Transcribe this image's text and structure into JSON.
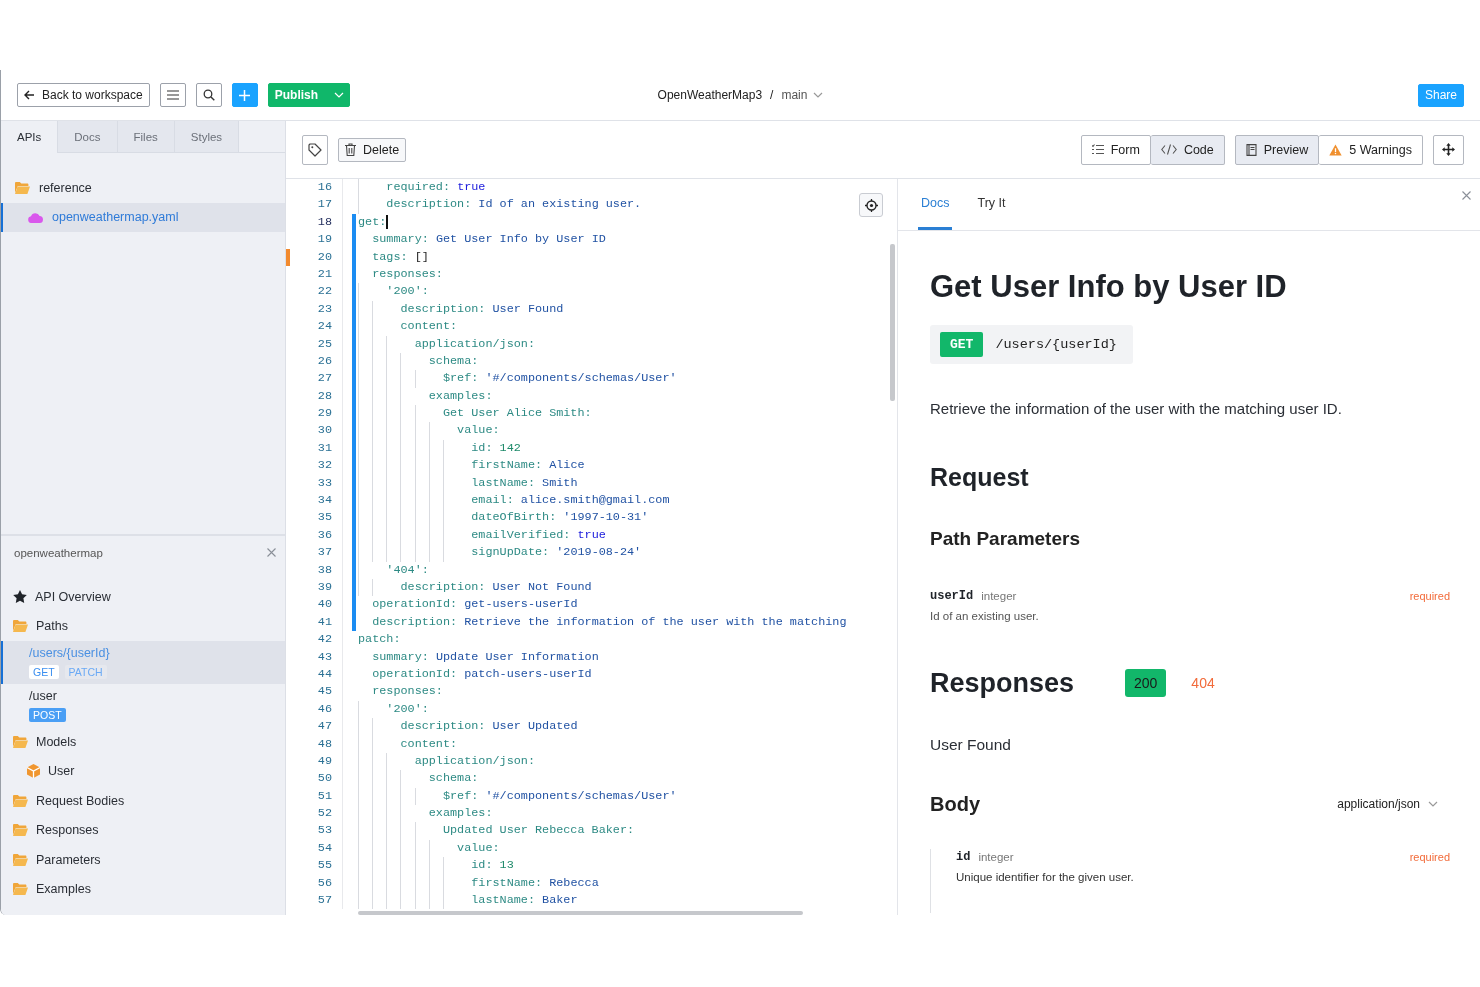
{
  "header": {
    "back_button": "Back to workspace",
    "publish_button": "Publish",
    "project": "OpenWeatherMap3",
    "separator": "/",
    "branch": "main",
    "share_button": "Share"
  },
  "sidebar": {
    "tabs": [
      {
        "label": "APIs",
        "selected": true
      },
      {
        "label": "Docs",
        "selected": false
      },
      {
        "label": "Files",
        "selected": false
      },
      {
        "label": "Styles",
        "selected": false
      }
    ],
    "file_tree": [
      {
        "label": "reference",
        "kind": "folder",
        "selected": false,
        "children": [
          {
            "label": "openweathermap.yaml",
            "kind": "file",
            "selected": true
          }
        ]
      }
    ],
    "outline": {
      "title": "openweathermap",
      "items": [
        {
          "label": "API Overview",
          "kind": "overview",
          "selected": false
        },
        {
          "label": "Paths",
          "kind": "folder",
          "selected": false,
          "children": [
            {
              "label": "/users/{userId}",
              "kind": "path",
              "selected": true,
              "methods": [
                {
                  "label": "GET",
                  "selected": true
                },
                {
                  "label": "PATCH",
                  "selected": false
                }
              ]
            },
            {
              "label": "/user",
              "kind": "path",
              "selected": false,
              "methods": [
                {
                  "label": "POST",
                  "selected": false
                }
              ]
            }
          ]
        },
        {
          "label": "Models",
          "kind": "folder",
          "selected": false,
          "children": [
            {
              "label": "User",
              "kind": "model",
              "selected": false
            }
          ]
        },
        {
          "label": "Request Bodies",
          "kind": "folder",
          "selected": false
        },
        {
          "label": "Responses",
          "kind": "folder",
          "selected": false
        },
        {
          "label": "Parameters",
          "kind": "folder",
          "selected": false
        },
        {
          "label": "Examples",
          "kind": "folder",
          "selected": false
        }
      ]
    }
  },
  "toolbar": {
    "delete_button": "Delete",
    "view_modes": [
      {
        "label": "Form",
        "kind": "form",
        "selected": false
      },
      {
        "label": "Code",
        "kind": "code",
        "selected": true
      }
    ],
    "panel_modes": [
      {
        "label": "Preview",
        "kind": "preview",
        "selected": true
      },
      {
        "label": "5 Warnings",
        "kind": "warnings",
        "selected": false
      }
    ]
  },
  "editor": {
    "lines": [
      {
        "children": [
          {
            "children": [
              {
                "num": "16",
                "key": "required:",
                "value": "true",
                "kind": "bool",
                "modified": false,
                "warning": false,
                "current": false
              },
              {
                "num": "17",
                "key": "description:",
                "value": "Id of an existing user.",
                "kind": "str",
                "modified": false,
                "warning": false,
                "current": false
              }
            ]
          }
        ]
      },
      {
        "num": "18",
        "key": "get:",
        "kind": "mapping",
        "modified": true,
        "warning": false,
        "current": true,
        "children": [
          {
            "num": "19",
            "key": "summary:",
            "value": "Get User Info by User ID",
            "kind": "str",
            "modified": true,
            "warning": false,
            "current": false
          },
          {
            "num": "20",
            "key": "tags:",
            "value": "[]",
            "kind": "plain",
            "modified": true,
            "warning": true,
            "current": false
          },
          {
            "num": "21",
            "key": "responses:",
            "kind": "mapping",
            "modified": true,
            "warning": false,
            "current": false,
            "children": [
              {
                "num": "22",
                "key": "'200':",
                "kind": "mapping",
                "modified": true,
                "warning": false,
                "current": false,
                "children": [
                  {
                    "num": "23",
                    "key": "description:",
                    "value": "User Found",
                    "kind": "str",
                    "modified": true,
                    "warning": false,
                    "current": false
                  },
                  {
                    "num": "24",
                    "key": "content:",
                    "kind": "mapping",
                    "modified": true,
                    "warning": false,
                    "current": false,
                    "children": [
                      {
                        "num": "25",
                        "key": "application/json:",
                        "kind": "mapping",
                        "modified": true,
                        "warning": false,
                        "current": false,
                        "children": [
                          {
                            "num": "26",
                            "key": "schema:",
                            "kind": "mapping",
                            "modified": true,
                            "warning": false,
                            "current": false,
                            "children": [
                              {
                                "num": "27",
                                "key": "$ref:",
                                "value": "'#/components/schemas/User'",
                                "kind": "str",
                                "modified": true,
                                "warning": false,
                                "current": false
                              }
                            ]
                          },
                          {
                            "num": "28",
                            "key": "examples:",
                            "kind": "mapping",
                            "modified": true,
                            "warning": false,
                            "current": false,
                            "children": [
                              {
                                "num": "29",
                                "key": "Get User Alice Smith:",
                                "kind": "mapping",
                                "modified": true,
                                "warning": false,
                                "current": false,
                                "children": [
                                  {
                                    "num": "30",
                                    "key": "value:",
                                    "kind": "mapping",
                                    "modified": true,
                                    "warning": false,
                                    "current": false,
                                    "children": [
                                      {
                                        "num": "31",
                                        "key": "id:",
                                        "value": "142",
                                        "kind": "num",
                                        "modified": true,
                                        "warning": false,
                                        "current": false
                                      },
                                      {
                                        "num": "32",
                                        "key": "firstName:",
                                        "value": "Alice",
                                        "kind": "str",
                                        "modified": true,
                                        "warning": false,
                                        "current": false
                                      },
                                      {
                                        "num": "33",
                                        "key": "lastName:",
                                        "value": "Smith",
                                        "kind": "str",
                                        "modified": true,
                                        "warning": false,
                                        "current": false
                                      },
                                      {
                                        "num": "34",
                                        "key": "email:",
                                        "value": "alice.smith@gmail.com",
                                        "kind": "str",
                                        "modified": true,
                                        "warning": false,
                                        "current": false
                                      },
                                      {
                                        "num": "35",
                                        "key": "dateOfBirth:",
                                        "value": "'1997-10-31'",
                                        "kind": "str",
                                        "modified": true,
                                        "warning": false,
                                        "current": false
                                      },
                                      {
                                        "num": "36",
                                        "key": "emailVerified:",
                                        "value": "true",
                                        "kind": "bool",
                                        "modified": true,
                                        "warning": false,
                                        "current": false
                                      },
                                      {
                                        "num": "37",
                                        "key": "signUpDate:",
                                        "value": "'2019-08-24'",
                                        "kind": "str",
                                        "modified": true,
                                        "warning": false,
                                        "current": false
                                      }
                                    ]
                                  }
                                ]
                              }
                            ]
                          }
                        ]
                      }
                    ]
                  }
                ]
              },
              {
                "num": "38",
                "key": "'404':",
                "kind": "mapping",
                "modified": true,
                "warning": false,
                "current": false,
                "children": [
                  {
                    "num": "39",
                    "key": "description:",
                    "value": "User Not Found",
                    "kind": "str",
                    "modified": true,
                    "warning": false,
                    "current": false
                  }
                ]
              }
            ]
          },
          {
            "num": "40",
            "key": "operationId:",
            "value": "get-users-userId",
            "kind": "str",
            "modified": true,
            "warning": false,
            "current": false
          },
          {
            "num": "41",
            "key": "description:",
            "value": "Retrieve the information of the user with the matching",
            "kind": "str",
            "modified": true,
            "warning": false,
            "current": false
          }
        ]
      },
      {
        "num": "42",
        "key": "patch:",
        "kind": "mapping",
        "modified": false,
        "warning": false,
        "current": false,
        "children": [
          {
            "num": "43",
            "key": "summary:",
            "value": "Update User Information",
            "kind": "str",
            "modified": false,
            "warning": false,
            "current": false
          },
          {
            "num": "44",
            "key": "operationId:",
            "value": "patch-users-userId",
            "kind": "str",
            "modified": false,
            "warning": false,
            "current": false
          },
          {
            "num": "45",
            "key": "responses:",
            "kind": "mapping",
            "modified": false,
            "warning": false,
            "current": false,
            "children": [
              {
                "num": "46",
                "key": "'200':",
                "kind": "mapping",
                "modified": false,
                "warning": false,
                "current": false,
                "children": [
                  {
                    "num": "47",
                    "key": "description:",
                    "value": "User Updated",
                    "kind": "str",
                    "modified": false,
                    "warning": false,
                    "current": false
                  },
                  {
                    "num": "48",
                    "key": "content:",
                    "kind": "mapping",
                    "modified": false,
                    "warning": false,
                    "current": false,
                    "children": [
                      {
                        "num": "49",
                        "key": "application/json:",
                        "kind": "mapping",
                        "modified": false,
                        "warning": false,
                        "current": false,
                        "children": [
                          {
                            "num": "50",
                            "key": "schema:",
                            "kind": "mapping",
                            "modified": false,
                            "warning": false,
                            "current": false,
                            "children": [
                              {
                                "num": "51",
                                "key": "$ref:",
                                "value": "'#/components/schemas/User'",
                                "kind": "str",
                                "modified": false,
                                "warning": false,
                                "current": false
                              }
                            ]
                          },
                          {
                            "num": "52",
                            "key": "examples:",
                            "kind": "mapping",
                            "modified": false,
                            "warning": false,
                            "current": false,
                            "children": [
                              {
                                "num": "53",
                                "key": "Updated User Rebecca Baker:",
                                "kind": "mapping",
                                "modified": false,
                                "warning": false,
                                "current": false,
                                "children": [
                                  {
                                    "num": "54",
                                    "key": "value:",
                                    "kind": "mapping",
                                    "modified": false,
                                    "warning": false,
                                    "current": false,
                                    "children": [
                                      {
                                        "num": "55",
                                        "key": "id:",
                                        "value": "13",
                                        "kind": "num",
                                        "modified": false,
                                        "warning": false,
                                        "current": false
                                      },
                                      {
                                        "num": "56",
                                        "key": "firstName:",
                                        "value": "Rebecca",
                                        "kind": "str",
                                        "modified": false,
                                        "warning": false,
                                        "current": false
                                      },
                                      {
                                        "num": "57",
                                        "key": "lastName:",
                                        "value": "Baker",
                                        "kind": "str",
                                        "modified": false,
                                        "warning": false,
                                        "current": false
                                      }
                                    ]
                                  }
                                ]
                              }
                            ]
                          }
                        ]
                      }
                    ]
                  }
                ]
              }
            ]
          }
        ]
      }
    ]
  },
  "docs": {
    "tabs": [
      {
        "label": "Docs",
        "selected": true
      },
      {
        "label": "Try It",
        "selected": false
      }
    ],
    "title": "Get User Info by User ID",
    "method": "GET",
    "path": "/users/{userId}",
    "description": "Retrieve the information of the user with the matching user ID.",
    "request_heading": "Request",
    "path_params_heading": "Path Parameters",
    "params": [
      {
        "name": "userId",
        "type": "integer",
        "required": "required",
        "description": "Id of an existing user."
      }
    ],
    "responses_heading": "Responses",
    "response_codes": [
      {
        "label": "200",
        "selected": true,
        "color": "#12b76a"
      },
      {
        "label": "404",
        "selected": false,
        "color": "#f26b3a"
      }
    ],
    "response_description": "User Found",
    "body_heading": "Body",
    "content_type": "application/json",
    "body_fields": [
      {
        "name": "id",
        "type": "integer",
        "required": "required",
        "description": "Unique identifier for the given user."
      }
    ]
  }
}
